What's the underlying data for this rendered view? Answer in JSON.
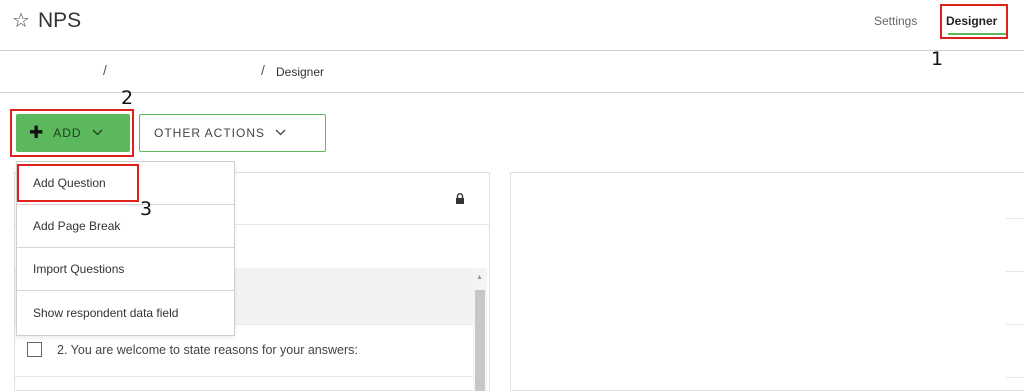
{
  "header": {
    "title": "NPS",
    "tabs": [
      {
        "label": "Settings",
        "active": false
      },
      {
        "label": "Designer",
        "active": true
      }
    ]
  },
  "breadcrumb": {
    "separator": "/",
    "current": "Designer"
  },
  "toolbar": {
    "add_label": "ADD",
    "other_actions_label": "OTHER ACTIONS"
  },
  "add_menu": {
    "items": [
      "Add Question",
      "Add Page Break",
      "Import Questions",
      "Show respondent data field"
    ]
  },
  "questions": [
    {
      "text": "2.  You are welcome to state reasons for your answers:",
      "checked": false
    }
  ],
  "annotations": [
    "1",
    "2",
    "3"
  ],
  "colors": {
    "accent": "#5cb85c",
    "annotation": "#e0201b"
  }
}
